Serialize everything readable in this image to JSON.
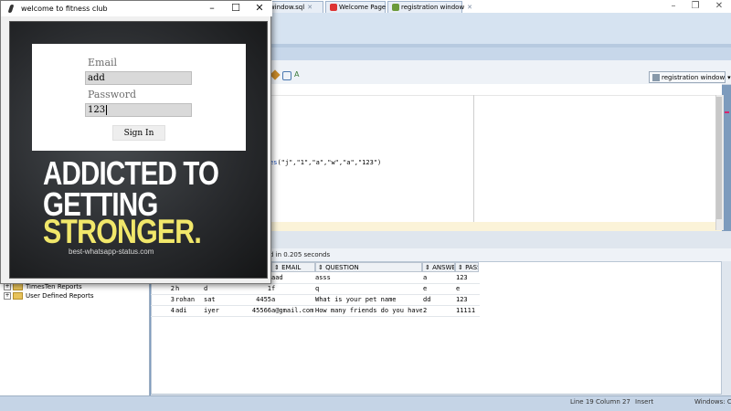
{
  "ide": {
    "tabs": [
      {
        "label": "window.sql",
        "icon": "sql-file-icon"
      },
      {
        "label": "Welcome Page",
        "icon": "oracle-icon"
      },
      {
        "label": "registration window",
        "icon": "connection-icon"
      }
    ],
    "connection_label": "registration window",
    "code_prefix": "es",
    "code_text": "(\"j\",\"1\",\"a\",\"w\",\"a\",\"123\")",
    "status_message": "d in 0.205 seconds",
    "results": {
      "columns": [
        "EMAIL",
        "QUESTION",
        "ANSWER",
        "PASS"
      ],
      "rows": [
        {
          "num": "",
          "c1": "",
          "c2": "",
          "c3": "",
          "email": "aad",
          "question": "asss",
          "answer": "a",
          "pass": "123"
        },
        {
          "num": "2",
          "c1": "h",
          "c2": "d",
          "c3": "1",
          "email": "f",
          "question": "q",
          "answer": "e",
          "pass": "e"
        },
        {
          "num": "3",
          "c1": "rohan",
          "c2": "sat",
          "c3": "4455",
          "email": "a",
          "question": "What is your pet name",
          "answer": "dd",
          "pass": "123"
        },
        {
          "num": "4",
          "c1": "adi",
          "c2": "iyer",
          "c3": "45566",
          "email": "a@gmail.com",
          "question": "How many friends do you have",
          "answer": "2",
          "pass": "11111"
        }
      ]
    },
    "navigator": [
      "TimesTen Reports",
      "User Defined Reports"
    ],
    "statusbar": {
      "position": "Line 19 Column 27",
      "mode": "Insert",
      "os": "Windows: CI"
    }
  },
  "login": {
    "window_title": "welcome to fitness club",
    "email_label": "Email",
    "email_value": "add",
    "password_label": "Password",
    "password_value": "123",
    "signin_label": "Sign In",
    "poster": {
      "line1": "ADDICTED TO",
      "line2": "GETTING",
      "line3": "STRONGER.",
      "site": "best-whatsapp-status.com"
    }
  },
  "colors": {
    "desktop": "#7d9bbd",
    "poster_accent": "#f1e76a",
    "keyword": "#1c4fb8"
  }
}
